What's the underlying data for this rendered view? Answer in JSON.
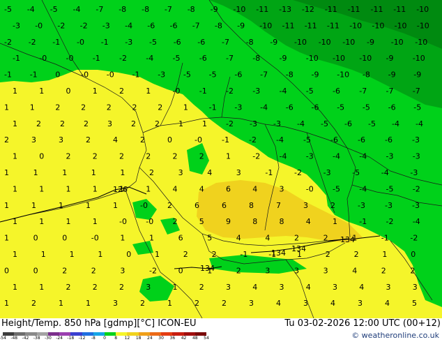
{
  "caption": {
    "left": "Height/Temp. 850 hPa [gdmp][°C] ICON-EU",
    "right": "Tu 03-02-2026 12:00 UTC (00+12)"
  },
  "credit": "© weatheronline.co.uk",
  "legend": {
    "ticks": [
      "-54",
      "-48",
      "-42",
      "-38",
      "-30",
      "-24",
      "-18",
      "-12",
      "-8",
      "0",
      "8",
      "12",
      "18",
      "24",
      "30",
      "36",
      "42",
      "48",
      "54"
    ],
    "colors": [
      "#3d3d3d",
      "#6e6e6e",
      "#8a8a8a",
      "#a3a3a3",
      "#7b2f8c",
      "#9b3fb0",
      "#3a3fd0",
      "#1f6fe0",
      "#16a5e6",
      "#00d11a",
      "#f5f52a",
      "#f0d21e",
      "#f0a01a",
      "#ec6a16",
      "#e43c12",
      "#c81e10",
      "#a00e0e",
      "#7a0a0a"
    ]
  },
  "map": {
    "contour_labels": [
      "126",
      "134",
      "134",
      "134",
      "134"
    ],
    "temperatures": [
      "-5",
      "-4",
      "-5",
      "-4",
      "-7",
      "-8",
      "-8",
      "-7",
      "-8",
      "-9",
      "-10",
      "-11",
      "-13",
      "-12",
      "-11",
      "-11",
      "-11",
      "-11",
      "-10",
      "-3",
      "-0",
      "-2",
      "-2",
      "-3",
      "-4",
      "-6",
      "-6",
      "-7",
      "-8",
      "-9",
      "-10",
      "-11",
      "-11",
      "-11",
      "-10",
      "-10",
      "-10",
      "-10",
      "-2",
      "-2",
      "-1",
      "-0",
      "-1",
      "-3",
      "-5",
      "-6",
      "-6",
      "-7",
      "-8",
      "-9",
      "-10",
      "-10",
      "-10",
      "-9",
      "-10",
      "-10",
      "-1",
      "-0",
      "-0",
      "-1",
      "-2",
      "-4",
      "-5",
      "-6",
      "-7",
      "-8",
      "-9",
      "-10",
      "-10",
      "-10",
      "-9",
      "-10",
      "-1",
      "-1",
      "0",
      "-0",
      "-0",
      "-1",
      "-3",
      "-5",
      "-5",
      "-6",
      "-7",
      "-8",
      "-9",
      "-10",
      "-8",
      "-9",
      "-9",
      "1",
      "1",
      "0",
      "1",
      "2",
      "1",
      "-0",
      "-1",
      "-2",
      "-3",
      "-4",
      "-5",
      "-6",
      "-7",
      "-7",
      "-7",
      "1",
      "1",
      "2",
      "2",
      "2",
      "2",
      "2",
      "1",
      "-1",
      "-3",
      "-4",
      "-6",
      "-6",
      "-5",
      "-5",
      "-6",
      "-5",
      "1",
      "2",
      "2",
      "2",
      "3",
      "2",
      "2",
      "1",
      "1",
      "-2",
      "-3",
      "-3",
      "-4",
      "-5",
      "-6",
      "-5",
      "-4",
      "-4",
      "2",
      "3",
      "3",
      "2",
      "4",
      "2",
      "0",
      "-0",
      "-1",
      "-2",
      "-4",
      "-5",
      "-6",
      "-6",
      "-6",
      "-3",
      "1",
      "0",
      "2",
      "2",
      "2",
      "2",
      "2",
      "2",
      "1",
      "-2",
      "-4",
      "-3",
      "-4",
      "-4",
      "-3",
      "-3",
      "1",
      "1",
      "1",
      "1",
      "1",
      "2",
      "3",
      "4",
      "3",
      "-1",
      "-2",
      "-3",
      "-5",
      "-4",
      "-3",
      "1",
      "1",
      "1",
      "1",
      "1",
      "1",
      "4",
      "4",
      "6",
      "4",
      "3",
      "-0",
      "-5",
      "-4",
      "-5",
      "-2",
      "1",
      "1",
      "1",
      "1",
      "1",
      "-0",
      "2",
      "6",
      "6",
      "8",
      "7",
      "3",
      "2",
      "-3",
      "-3",
      "-3",
      "1",
      "1",
      "1",
      "1",
      "-0",
      "-0",
      "2",
      "5",
      "9",
      "8",
      "8",
      "4",
      "1",
      "-1",
      "-2",
      "-4",
      "1",
      "0",
      "0",
      "-0",
      "1",
      "1",
      "6",
      "5",
      "4",
      "4",
      "2",
      "2",
      "1",
      "-1",
      "-2",
      "1",
      "1",
      "1",
      "1",
      "0",
      "1",
      "2",
      "2",
      "-1",
      "-1",
      "1",
      "2",
      "2",
      "1",
      "0",
      "0",
      "0",
      "2",
      "2",
      "3",
      "-2",
      "0",
      "1",
      "2",
      "3",
      "3",
      "3",
      "4",
      "2",
      "2",
      "1",
      "1",
      "2",
      "2",
      "2",
      "3",
      "1",
      "2",
      "3",
      "4",
      "3",
      "4",
      "3",
      "4",
      "3",
      "3",
      "1",
      "2",
      "1",
      "1",
      "3",
      "2",
      "1",
      "2",
      "2",
      "3",
      "4",
      "3",
      "4",
      "3",
      "4",
      "5"
    ]
  }
}
